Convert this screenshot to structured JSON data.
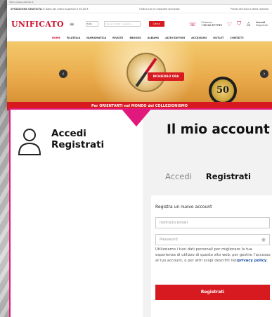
{
  "browser": {
    "url": "https://www.unificato.it"
  },
  "site": {
    "announce_left_bold": "SPEDIZIONE GRATUITA",
    "announce_left": "in Italia per ordini superiori a 90,00 €",
    "announce_mid": "Ordina con le massime sicurezze",
    "announce_right": "Prezzi dell'euro e della moneta",
    "logo": "UNIFICATO",
    "search_select": "Tutte",
    "search_placeholder": "Cerca in tutto il negozio...",
    "search_button": "Cerca",
    "phone_label": "Chiamaci",
    "phone": "+39 02 877759",
    "account_label": "Accedi",
    "register_label": "Registrati",
    "nav": [
      "HOME",
      "FILATELIA",
      "NUMISMATICA",
      "RIVISTE",
      "EBOOKS",
      "ALBUMS",
      "ALTRI EDITORI",
      "ACCESSORI",
      "OUTLET",
      "CONTATTI"
    ],
    "hero_cta": "RICHIEDILO ORA",
    "hero_badge": "50",
    "hero_strip": "Per ORIENTARTI nel MONDO del COLLEZIONISMO"
  },
  "panel": {
    "left_links": [
      "Accedi",
      "Registrati"
    ],
    "title": "Il mio account",
    "tabs": [
      "Accedi",
      "Registrati"
    ],
    "form_title": "Registra un nuovo account",
    "email_placeholder": "Indirizzo email",
    "password_placeholder": "Password",
    "privacy_text": "Utilizziamo i tuoi dati personali per migliorare la tua esperienza di utilizzo di questo sito web, per gestire l'accesso al tuo account, e per altri scopi descritti nell",
    "privacy_link": "privacy policy",
    "privacy_end": ".",
    "register_button": "Registrati"
  },
  "colors": {
    "brand_red": "#d71920",
    "accent_pink": "#e1197e"
  }
}
